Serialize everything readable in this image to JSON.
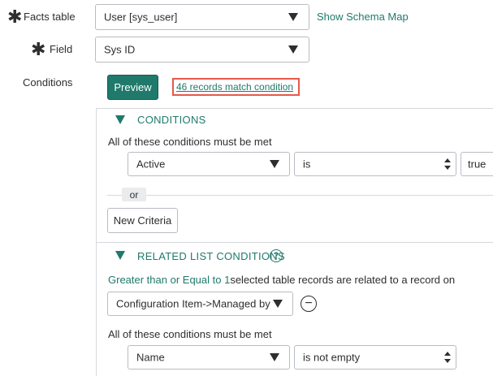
{
  "fields": {
    "facts_table_label": "Facts table",
    "facts_table_value": "User [sys_user]",
    "show_schema_map": "Show Schema Map",
    "field_label": "Field",
    "field_value": "Sys ID",
    "conditions_label": "Conditions"
  },
  "actions": {
    "preview_label": "Preview",
    "match_text": "46 records match condition"
  },
  "conditions": {
    "title": "CONDITIONS",
    "all_met": "All of these conditions must be met",
    "field": "Active",
    "operator": "is",
    "value": "true",
    "or_label": "or",
    "new_criteria": "New Criteria"
  },
  "related": {
    "title": "RELATED LIST CONDITIONS",
    "help_icon_glyph": "?",
    "quantity_link": "Greater than or Equal to 1",
    "relation_text": "selected table records are related to a record on",
    "list_value": "Configuration Item->Managed by",
    "remove_icon_glyph": "−",
    "all_met": "All of these conditions must be met",
    "field": "Name",
    "operator": "is not empty"
  },
  "colors": {
    "accent_green": "#1f7a6c",
    "highlight_red": "#e8584a"
  }
}
